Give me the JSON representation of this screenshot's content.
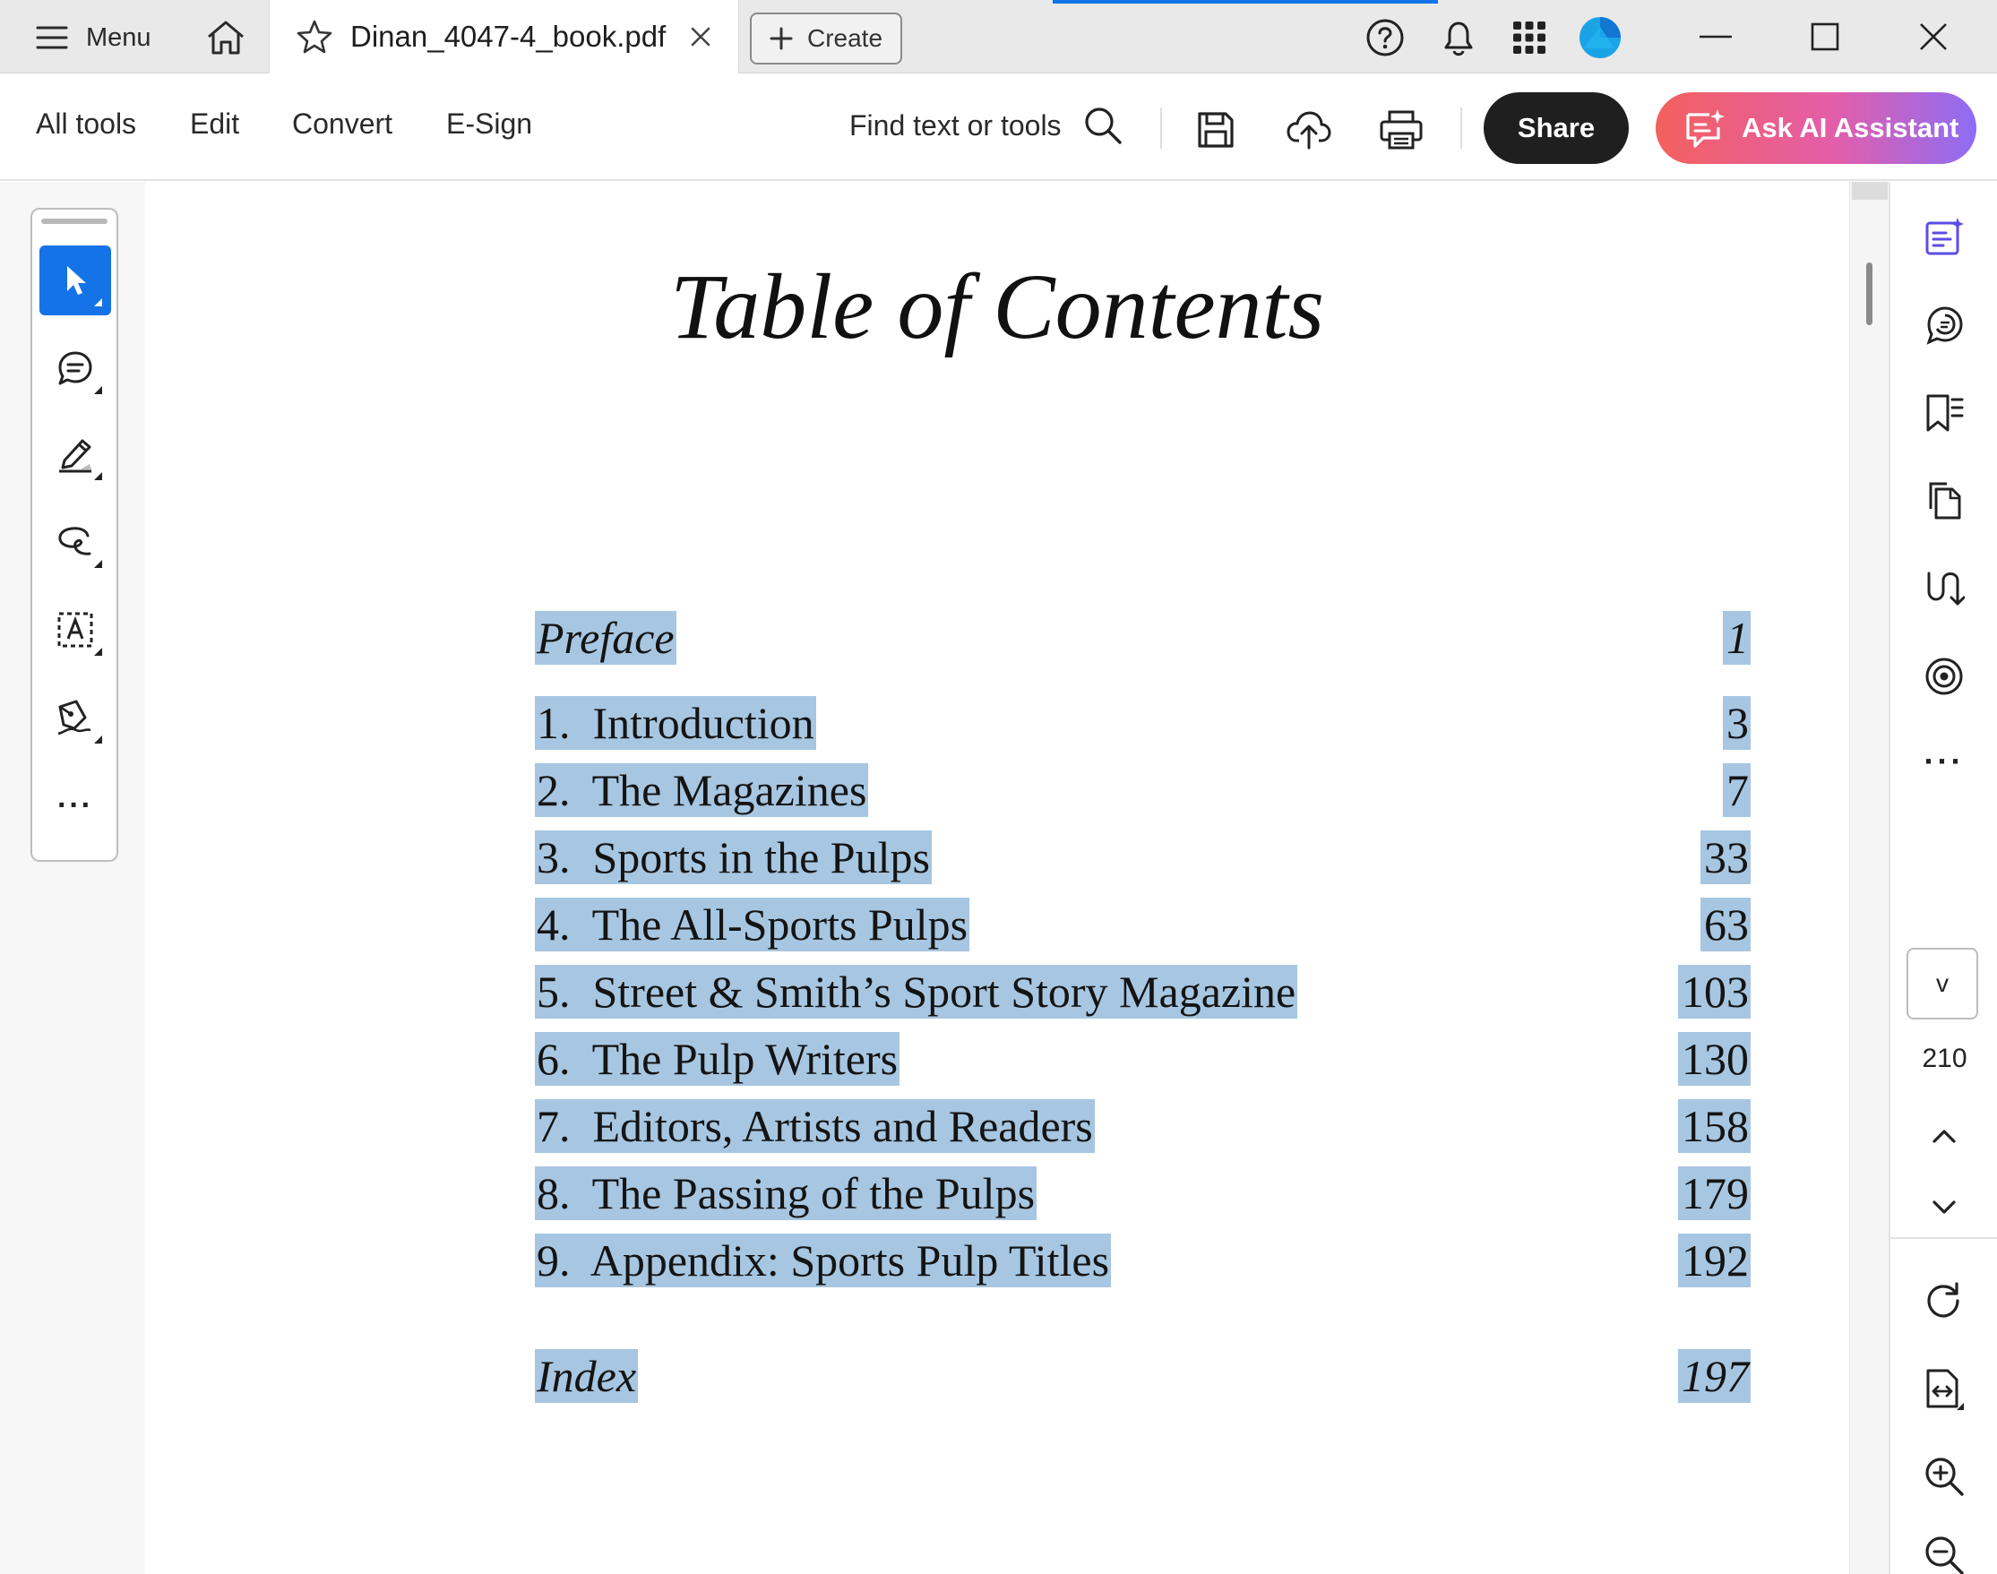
{
  "titlebar": {
    "menu_label": "Menu",
    "tab_title": "Dinan_4047-4_book.pdf",
    "create_label": "Create",
    "icons": [
      "hamburger-icon",
      "home-icon",
      "star-icon",
      "close-icon",
      "plus-icon",
      "help-icon",
      "bell-icon",
      "apps-grid-icon",
      "avatar",
      "minimize-icon",
      "maximize-icon",
      "close-window-icon"
    ],
    "accent": "#1473e6"
  },
  "toolbar": {
    "nav": [
      "All tools",
      "Edit",
      "Convert",
      "E-Sign"
    ],
    "find_label": "Find text or tools",
    "share_label": "Share",
    "ai_label": "Ask AI Assistant",
    "icons": [
      "search-icon",
      "save-icon",
      "upload-icon",
      "print-icon",
      "ai-chat-icon"
    ]
  },
  "left_rail": {
    "tools": [
      "select-icon",
      "comment-icon",
      "highlight-icon",
      "draw-icon",
      "text-select-icon",
      "sign-icon"
    ],
    "more": "···"
  },
  "document": {
    "title": "Table of Contents",
    "entries": [
      {
        "title": "Preface",
        "page": "1"
      },
      {
        "title": "1.  Introduction",
        "page": "3"
      },
      {
        "title": "2.  The Magazines",
        "page": "7"
      },
      {
        "title": "3.  Sports in the Pulps",
        "page": "33"
      },
      {
        "title": "4.  The All-Sports Pulps",
        "page": "63"
      },
      {
        "title": "5.  Street & Smith’s Sport Story Magazine",
        "page": "103"
      },
      {
        "title": "6.  The Pulp Writers",
        "page": "130"
      },
      {
        "title": "7.  Editors, Artists and Readers",
        "page": "158"
      },
      {
        "title": "8.  The Passing of the Pulps",
        "page": "179"
      },
      {
        "title": "9.  Appendix: Sports Pulp Titles",
        "page": "192"
      },
      {
        "title": "Index",
        "page": "197"
      }
    ],
    "highlight_color": "#a7c6e1"
  },
  "right_panel": {
    "icons": [
      "ai-summary-icon",
      "comments-panel-icon",
      "bookmarks-icon",
      "pages-icon",
      "compare-icon",
      "accessibility-icon",
      "rotate-icon",
      "fit-page-icon",
      "zoom-in-icon",
      "zoom-out-icon"
    ],
    "more": "···",
    "current_page": "v",
    "total_pages": "210"
  }
}
